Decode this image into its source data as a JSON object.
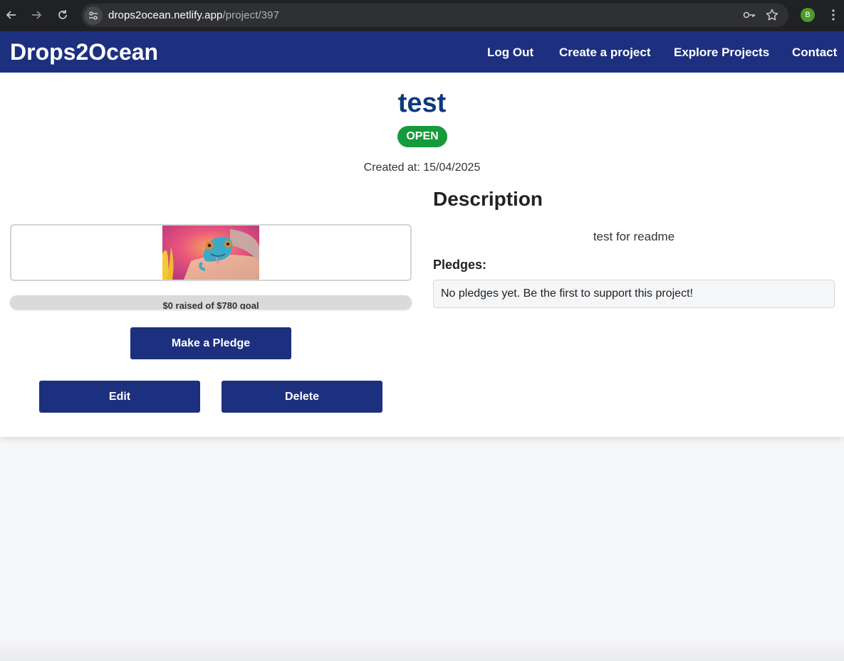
{
  "browser": {
    "url_host": "drops2ocean.netlify.app",
    "url_path": "/project/397",
    "profile_initial": "B"
  },
  "site": {
    "logo": "Drops2Ocean",
    "nav": [
      "Log Out",
      "Create a project",
      "Explore Projects",
      "Contact"
    ]
  },
  "project": {
    "title": "test",
    "status": "OPEN",
    "created": "Created at: 15/04/2025",
    "progress_text": "$0 raised of $780 goal",
    "progress_fraction": 0,
    "pledge_button": "Make a Pledge",
    "edit_button": "Edit",
    "delete_button": "Delete",
    "description_heading": "Description",
    "description": "test for readme",
    "pledges_heading": "Pledges:",
    "pledges_empty": "No pledges yet. Be the first to support this project!"
  },
  "colors": {
    "brand": "#1d307f",
    "title": "#0b3a7e",
    "status_open": "#159a3c"
  },
  "icons": [
    "back-arrow-icon",
    "forward-arrow-icon",
    "reload-icon",
    "site-info-icon",
    "password-key-icon",
    "bookmark-star-icon",
    "more-options-icon"
  ]
}
